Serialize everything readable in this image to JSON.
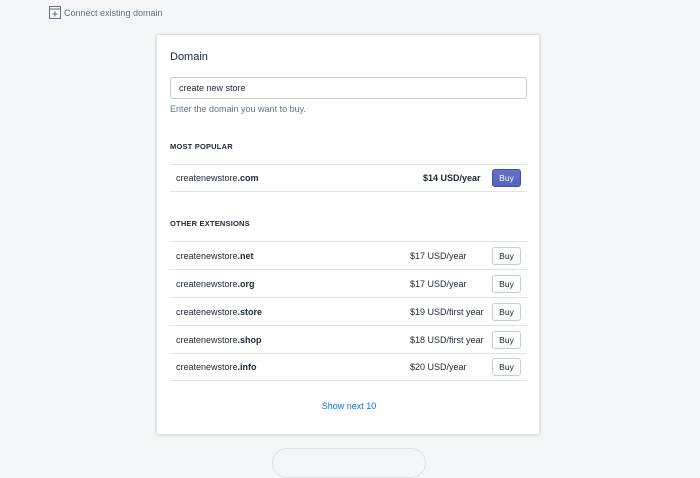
{
  "connect_link": {
    "label": "Connect existing domain",
    "icon": "connect-domain-icon"
  },
  "card": {
    "title": "Domain",
    "input": {
      "value": "create new store",
      "placeholder": ""
    },
    "help_text": "Enter the domain you want to buy."
  },
  "most_popular": {
    "heading": "MOST POPULAR",
    "items": [
      {
        "base": "createnewstore",
        "tld": ".com",
        "price": "$14 USD/year",
        "buy_label": "Buy"
      }
    ]
  },
  "other_extensions": {
    "heading": "OTHER EXTENSIONS",
    "items": [
      {
        "base": "createnewstore",
        "tld": ".net",
        "price": "$17 USD/year",
        "buy_label": "Buy"
      },
      {
        "base": "createnewstore",
        "tld": ".org",
        "price": "$17 USD/year",
        "buy_label": "Buy"
      },
      {
        "base": "createnewstore",
        "tld": ".store",
        "price": "$19 USD/first year",
        "buy_label": "Buy"
      },
      {
        "base": "createnewstore",
        "tld": ".shop",
        "price": "$18 USD/first year",
        "buy_label": "Buy"
      },
      {
        "base": "createnewstore",
        "tld": ".info",
        "price": "$20 USD/year",
        "buy_label": "Buy"
      }
    ]
  },
  "show_next_label": "Show next 10",
  "colors": {
    "primary": "#5c6ac4",
    "link": "#007ace",
    "background": "#f4f6f8"
  }
}
